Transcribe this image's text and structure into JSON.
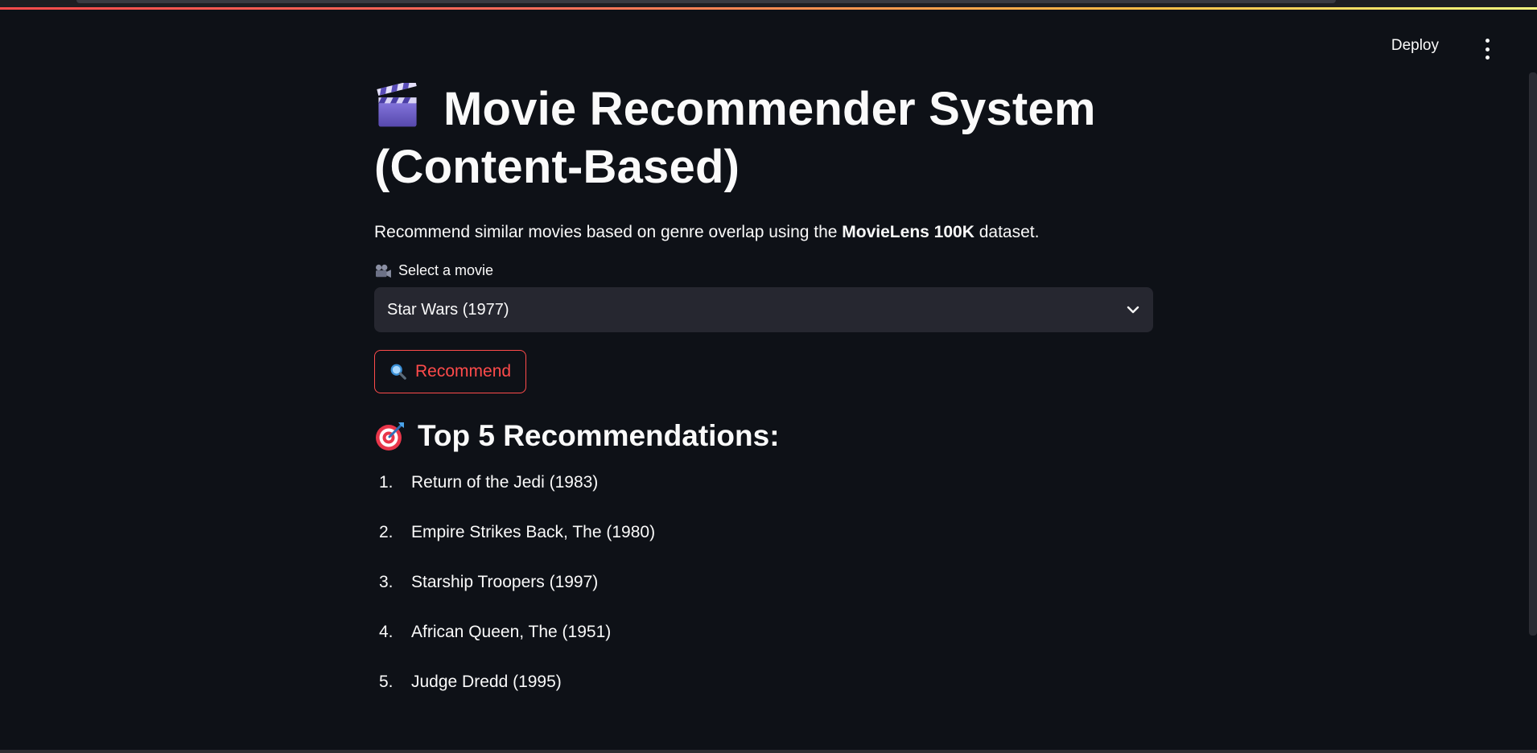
{
  "header": {
    "deploy_label": "Deploy",
    "menu_icon": "vertical-ellipsis-icon"
  },
  "main": {
    "title_icon": "clapper-board-icon",
    "title": "Movie Recommender System (Content-Based)",
    "description_prefix": "Recommend similar movies based on genre overlap using the ",
    "description_bold": "MovieLens 100K",
    "description_suffix": " dataset.",
    "select_label_icon": "movie-camera-icon",
    "select_label": "Select a movie",
    "select_value": "Star Wars (1977)",
    "recommend_icon": "magnifying-glass-icon",
    "recommend_label": "Recommend",
    "results_icon": "direct-hit-target-icon",
    "results_title": "Top 5 Recommendations:",
    "recommendations": [
      {
        "num": "1.",
        "title": "Return of the Jedi (1983)"
      },
      {
        "num": "2.",
        "title": "Empire Strikes Back, The (1980)"
      },
      {
        "num": "3.",
        "title": "Starship Troopers (1997)"
      },
      {
        "num": "4.",
        "title": "African Queen, The (1951)"
      },
      {
        "num": "5.",
        "title": "Judge Dredd (1995)"
      }
    ]
  },
  "colors": {
    "background": "#0e1117",
    "accent": "#ff4b4b",
    "select_bg": "#262730",
    "text": "#fafafa"
  }
}
